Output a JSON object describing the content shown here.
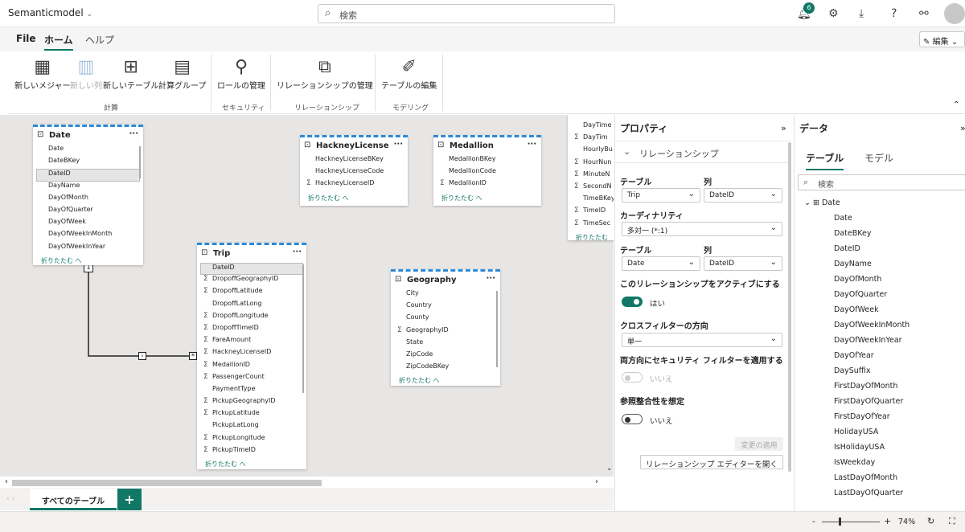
{
  "app": {
    "title": "Semanticmodel",
    "search_placeholder": "検索",
    "notification_count": "6",
    "edit_label": "編集"
  },
  "menu": {
    "file": "File",
    "home": "ホーム",
    "help": "ヘルプ"
  },
  "ribbon": {
    "buttons": [
      "新しいメジャー",
      "新しい列",
      "新しいテーブル",
      "計算グループ",
      "ロールの管理",
      "リレーションシップの管理",
      "テーブルの編集"
    ],
    "groups": [
      "計算",
      "セキュリティ",
      "リレーションシップ",
      "モデリング"
    ]
  },
  "canvas": {
    "collapse_label": "折りたたむ へ",
    "rel_labels": {
      "one": "1",
      "many": "*"
    },
    "tables": {
      "date": {
        "name": "Date",
        "fields": [
          "Date",
          "DateBKey",
          "DateID",
          "DayName",
          "DayOfMonth",
          "DayOfQuarter",
          "DayOfWeek",
          "DayOfWeekInMonth",
          "DayOfWeekInYear"
        ]
      },
      "hackney": {
        "name": "HackneyLicense",
        "fields": [
          "HackneyLicenseBKey",
          "HackneyLicenseCode",
          "HackneyLicenseID"
        ]
      },
      "medallion": {
        "name": "Medallion",
        "fields": [
          "MedallionBKey",
          "MedallionCode",
          "MedallionID"
        ]
      },
      "time": {
        "fields": [
          "DayTime",
          "DayTim",
          "HourlyBu",
          "HourNun",
          "MinuteN",
          "SecondN",
          "TimeBKey",
          "TimeID",
          "TimeSec"
        ]
      },
      "trip": {
        "name": "Trip",
        "fields": [
          "DateID",
          "DropoffGeographyID",
          "DropoffLatitude",
          "DropoffLatLong",
          "DropoffLongitude",
          "DropoffTimeID",
          "FareAmount",
          "HackneyLicenseID",
          "MedallionID",
          "PassengerCount",
          "PaymentType",
          "PickupGeographyID",
          "PickupLatitude",
          "PickupLatLong",
          "PickupLongitude",
          "PickupTimeID"
        ]
      },
      "geography": {
        "name": "Geography",
        "fields": [
          "City",
          "Country",
          "County",
          "GeographyID",
          "State",
          "ZipCode",
          "ZipCodeBKey"
        ]
      }
    },
    "sheet_tab": "すべてのテーブル"
  },
  "properties": {
    "title": "プロパティ",
    "section": "リレーションシップ",
    "table_label": "テーブル",
    "column_label": "列",
    "table1": "Trip",
    "column1": "DateID",
    "cardinality_label": "カーディナリティ",
    "cardinality": "多対一 (*:1)",
    "table2": "Date",
    "column2": "DateID",
    "active_label": "このリレーションシップをアクティブにする",
    "active_value": "はい",
    "crossfilter_label": "クロスフィルターの方向",
    "crossfilter": "単一",
    "security_label": "両方向にセキュリティ フィルターを適用する",
    "security_value": "いいえ",
    "integrity_label": "参照整合性を想定",
    "integrity_value": "いいえ",
    "apply_button": "変更の適用",
    "open_editor_button": "リレーションシップ エディターを開く"
  },
  "data_pane": {
    "title": "データ",
    "tab_tables": "テーブル",
    "tab_model": "モデル",
    "search_placeholder": "検索",
    "table_name": "Date",
    "fields": [
      "Date",
      "DateBKey",
      "DateID",
      "DayName",
      "DayOfMonth",
      "DayOfQuarter",
      "DayOfWeek",
      "DayOfWeekInMonth",
      "DayOfWeekInYear",
      "DayOfYear",
      "DaySuffix",
      "FirstDayOfMonth",
      "FirstDayOfQuarter",
      "FirstDayOfYear",
      "HolidayUSA",
      "IsHolidayUSA",
      "IsWeekday",
      "LastDayOfMonth",
      "LastDayOfQuarter"
    ]
  },
  "status": {
    "zoom": "74%"
  },
  "colors": {
    "accent": "#117865",
    "dashed_border": "#2b8ad8"
  }
}
